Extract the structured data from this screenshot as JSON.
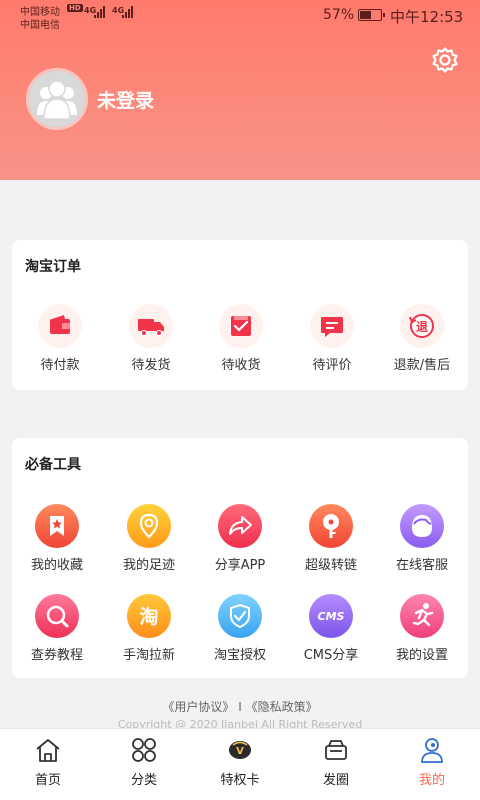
{
  "status_bar": {
    "carrier_1": "中国移动",
    "carrier_2": "中国电信",
    "hd": "HD",
    "net_1": "4G",
    "net_2": "4G",
    "battery": "57%",
    "battery_level": 0.57,
    "time": "中午12:53"
  },
  "profile": {
    "login_status": "未登录"
  },
  "orders": {
    "title": "淘宝订单",
    "items": [
      {
        "label": "待付款",
        "icon": "wallet-icon"
      },
      {
        "label": "待发货",
        "icon": "truck-icon"
      },
      {
        "label": "待收货",
        "icon": "received-box-icon"
      },
      {
        "label": "待评价",
        "icon": "comment-icon"
      },
      {
        "label": "退款/售后",
        "icon": "refund-icon"
      }
    ]
  },
  "tools": {
    "title": "必备工具",
    "items": [
      {
        "label": "我的收藏",
        "icon": "favorite-icon"
      },
      {
        "label": "我的足迹",
        "icon": "footprint-icon"
      },
      {
        "label": "分享APP",
        "icon": "share-icon"
      },
      {
        "label": "超级转链",
        "icon": "link-convert-icon"
      },
      {
        "label": "在线客服",
        "icon": "customer-service-icon"
      },
      {
        "label": "查券教程",
        "icon": "coupon-tutorial-icon"
      },
      {
        "label": "手淘拉新",
        "icon": "taobao-invite-icon",
        "glyph": "淘"
      },
      {
        "label": "淘宝授权",
        "icon": "taobao-auth-icon"
      },
      {
        "label": "CMS分享",
        "icon": "cms-share-icon",
        "glyph": "CMS"
      },
      {
        "label": "我的设置",
        "icon": "settings-runner-icon"
      }
    ]
  },
  "footer": {
    "links": "《用户协议》 I 《隐私政策》",
    "copyright": "Copyright @ 2020 Jianbei All Right Reserved"
  },
  "tabbar": {
    "items": [
      {
        "label": "首页",
        "icon": "home-icon"
      },
      {
        "label": "分类",
        "icon": "category-icon"
      },
      {
        "label": "特权卡",
        "icon": "vip-card-icon",
        "glyph": "V"
      },
      {
        "label": "发圈",
        "icon": "moments-icon"
      },
      {
        "label": "我的",
        "icon": "profile-icon",
        "active": true
      }
    ]
  },
  "colors": {
    "header_top": "#ff7a6d",
    "header_bottom": "#f99387",
    "accent": "#f26a55"
  }
}
